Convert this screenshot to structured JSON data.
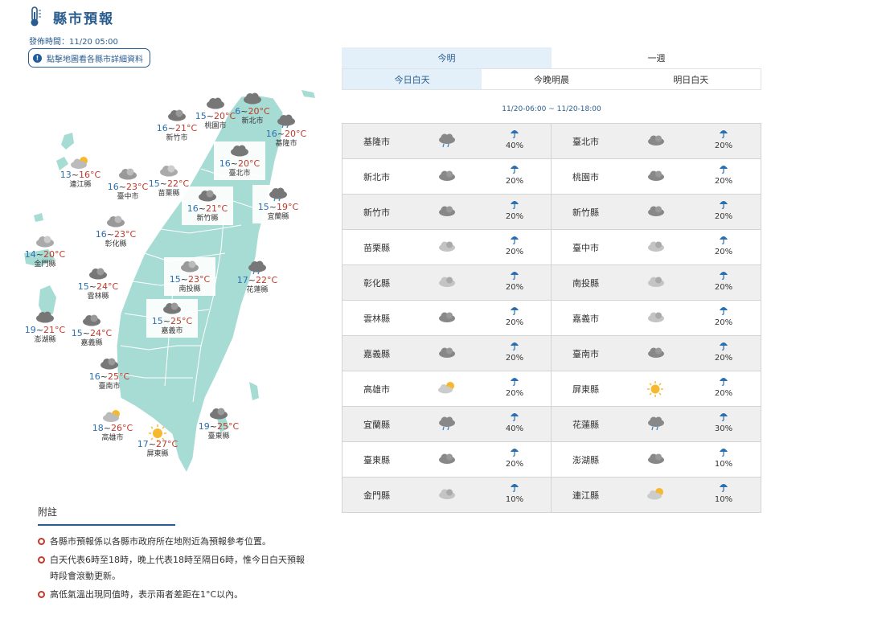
{
  "header": {
    "title": "縣市預報",
    "issue_time": "發佈時間：11/20 05:00",
    "map_hint": "點擊地圖看各縣市詳細資料"
  },
  "tabs": {
    "main": [
      "今明",
      "一週"
    ],
    "sub": [
      "今日白天",
      "今晚明晨",
      "明日白天"
    ]
  },
  "period": "11/20-06:00 ~ 11/20-18:00",
  "map": [
    {
      "name": "新北市",
      "lo": "6",
      "hi": "20"
    },
    {
      "name": "桃園市",
      "lo": "15",
      "hi": "20"
    },
    {
      "name": "新竹市",
      "lo": "16",
      "hi": "21"
    },
    {
      "name": "基隆市",
      "lo": "16",
      "hi": "20"
    },
    {
      "name": "臺北市",
      "lo": "16",
      "hi": "20"
    },
    {
      "name": "連江縣",
      "lo": "13",
      "hi": "16"
    },
    {
      "name": "臺中市",
      "lo": "16",
      "hi": "23"
    },
    {
      "name": "苗栗縣",
      "lo": "15",
      "hi": "22"
    },
    {
      "name": "新竹縣",
      "lo": "16",
      "hi": "21"
    },
    {
      "name": "宜蘭縣",
      "lo": "15",
      "hi": "19"
    },
    {
      "name": "彰化縣",
      "lo": "16",
      "hi": "23"
    },
    {
      "name": "金門縣",
      "lo": "14",
      "hi": "20"
    },
    {
      "name": "南投縣",
      "lo": "15",
      "hi": "23"
    },
    {
      "name": "花蓮縣",
      "lo": "17",
      "hi": "22"
    },
    {
      "name": "雲林縣",
      "lo": "15",
      "hi": "24"
    },
    {
      "name": "嘉義市",
      "lo": "15",
      "hi": "25"
    },
    {
      "name": "澎湖縣",
      "lo": "19",
      "hi": "21"
    },
    {
      "name": "嘉義縣",
      "lo": "15",
      "hi": "24"
    },
    {
      "name": "臺南市",
      "lo": "16",
      "hi": "25"
    },
    {
      "name": "高雄市",
      "lo": "18",
      "hi": "26"
    },
    {
      "name": "屏東縣",
      "lo": "17",
      "hi": "27"
    },
    {
      "name": "臺東縣",
      "lo": "19",
      "hi": "25"
    }
  ],
  "forecast": [
    [
      {
        "name": "基隆市",
        "icon": "rain-cloud-icon",
        "pop": "40%"
      },
      {
        "name": "臺北市",
        "icon": "cloud-icon",
        "pop": "20%"
      }
    ],
    [
      {
        "name": "新北市",
        "icon": "cloud-icon",
        "pop": "20%"
      },
      {
        "name": "桃園市",
        "icon": "cloud-icon",
        "pop": "20%"
      }
    ],
    [
      {
        "name": "新竹市",
        "icon": "cloud-icon",
        "pop": "20%"
      },
      {
        "name": "新竹縣",
        "icon": "cloud-icon",
        "pop": "20%"
      }
    ],
    [
      {
        "name": "苗栗縣",
        "icon": "cloudy-icon",
        "pop": "20%"
      },
      {
        "name": "臺中市",
        "icon": "cloudy-icon",
        "pop": "20%"
      }
    ],
    [
      {
        "name": "彰化縣",
        "icon": "cloudy-icon",
        "pop": "20%"
      },
      {
        "name": "南投縣",
        "icon": "cloudy-icon",
        "pop": "20%"
      }
    ],
    [
      {
        "name": "雲林縣",
        "icon": "cloud-icon",
        "pop": "20%"
      },
      {
        "name": "嘉義市",
        "icon": "cloudy-icon",
        "pop": "20%"
      }
    ],
    [
      {
        "name": "嘉義縣",
        "icon": "cloud-icon",
        "pop": "20%"
      },
      {
        "name": "臺南市",
        "icon": "cloud-icon",
        "pop": "20%"
      }
    ],
    [
      {
        "name": "高雄市",
        "icon": "partly-sunny-icon",
        "pop": "20%"
      },
      {
        "name": "屏東縣",
        "icon": "sunny-icon",
        "pop": "20%"
      }
    ],
    [
      {
        "name": "宜蘭縣",
        "icon": "rain-cloud-icon",
        "pop": "40%"
      },
      {
        "name": "花蓮縣",
        "icon": "rain-cloud-icon",
        "pop": "30%"
      }
    ],
    [
      {
        "name": "臺東縣",
        "icon": "cloud-icon",
        "pop": "20%"
      },
      {
        "name": "澎湖縣",
        "icon": "cloud-icon",
        "pop": "10%"
      }
    ],
    [
      {
        "name": "金門縣",
        "icon": "cloudy-icon",
        "pop": "10%"
      },
      {
        "name": "連江縣",
        "icon": "partly-sunny-icon",
        "pop": "10%"
      }
    ]
  ],
  "notes": {
    "title": "附註",
    "items": [
      "各縣市預報係以各縣市政府所在地附近為預報參考位置。",
      "白天代表6時至18時，晚上代表18時至隔日6時，惟今日白天預報時段會滾動更新。",
      "高低氣溫出現同值時，表示兩者差距在1°C以內。"
    ]
  },
  "colors": {
    "accent": "#2a5d8f",
    "map_land": "#a7dcd4",
    "bullet": "#c0392b"
  }
}
